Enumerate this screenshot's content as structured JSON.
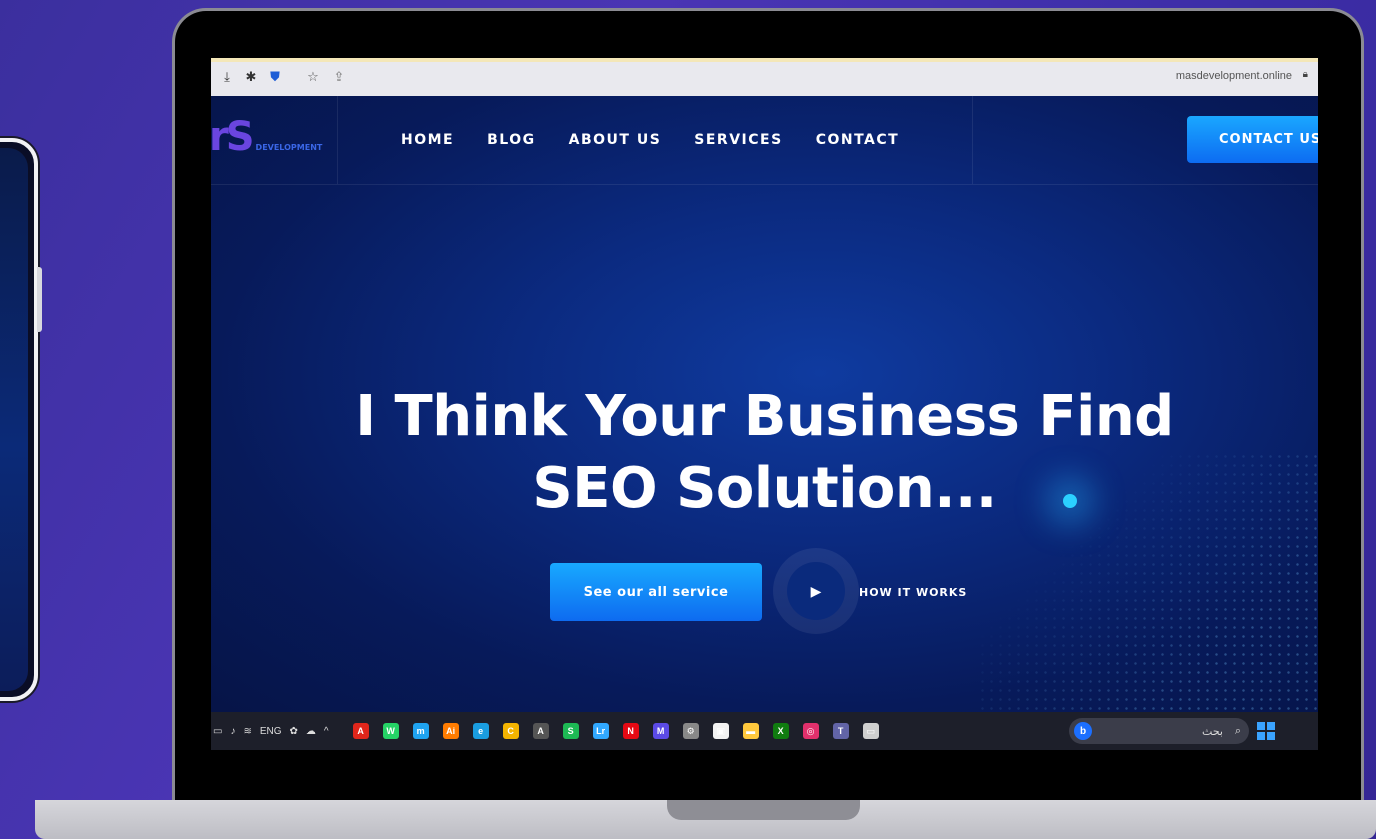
{
  "browser": {
    "url": "masdevelopment.online",
    "icons": [
      "download-icon",
      "extension-icon",
      "shield-icon",
      "star-icon",
      "share-icon"
    ]
  },
  "site": {
    "logo_text": "rS",
    "logo_sub": "DEVELOPMENT",
    "nav": [
      "HOME",
      "BLOG",
      "ABOUT US",
      "SERVICES",
      "CONTACT"
    ],
    "cta_label": "CONTACT US",
    "hero_line1": "I Think Your Business Find",
    "hero_line2": "SEO Solution...",
    "primary_button": "See our all service",
    "how_it_works": "HOW IT WORKS"
  },
  "taskbar": {
    "language": "ENG",
    "search_text": "بحث",
    "search_badge": "b",
    "apps": [
      {
        "name": "acrobat-icon",
        "color": "#e0261b",
        "glyph": "A"
      },
      {
        "name": "whatsapp-icon",
        "color": "#25d366",
        "glyph": "W"
      },
      {
        "name": "messenger-icon",
        "color": "#1fa3f0",
        "glyph": "m"
      },
      {
        "name": "illustrator-icon",
        "color": "#ff7c00",
        "glyph": "Ai"
      },
      {
        "name": "edge-icon",
        "color": "#1a9de0",
        "glyph": "e"
      },
      {
        "name": "chrome-icon",
        "color": "#f4b400",
        "glyph": "C"
      },
      {
        "name": "app-a-icon",
        "color": "#555",
        "glyph": "A"
      },
      {
        "name": "spotify-icon",
        "color": "#1db954",
        "glyph": "S"
      },
      {
        "name": "lightroom-icon",
        "color": "#31a8ff",
        "glyph": "Lr"
      },
      {
        "name": "netflix-icon",
        "color": "#e50914",
        "glyph": "N"
      },
      {
        "name": "app-m-icon",
        "color": "#5b4ae6",
        "glyph": "M"
      },
      {
        "name": "settings-icon",
        "color": "#888",
        "glyph": "⚙"
      },
      {
        "name": "store-icon",
        "color": "#f2f2f2",
        "glyph": "▣"
      },
      {
        "name": "explorer-icon",
        "color": "#ffc83d",
        "glyph": "▬"
      },
      {
        "name": "xbox-icon",
        "color": "#107c10",
        "glyph": "X"
      },
      {
        "name": "instagram-icon",
        "color": "#e1306c",
        "glyph": "◎"
      },
      {
        "name": "teams-icon",
        "color": "#6264a7",
        "glyph": "T"
      },
      {
        "name": "window-icon",
        "color": "#cfcfcf",
        "glyph": "▭"
      }
    ]
  }
}
